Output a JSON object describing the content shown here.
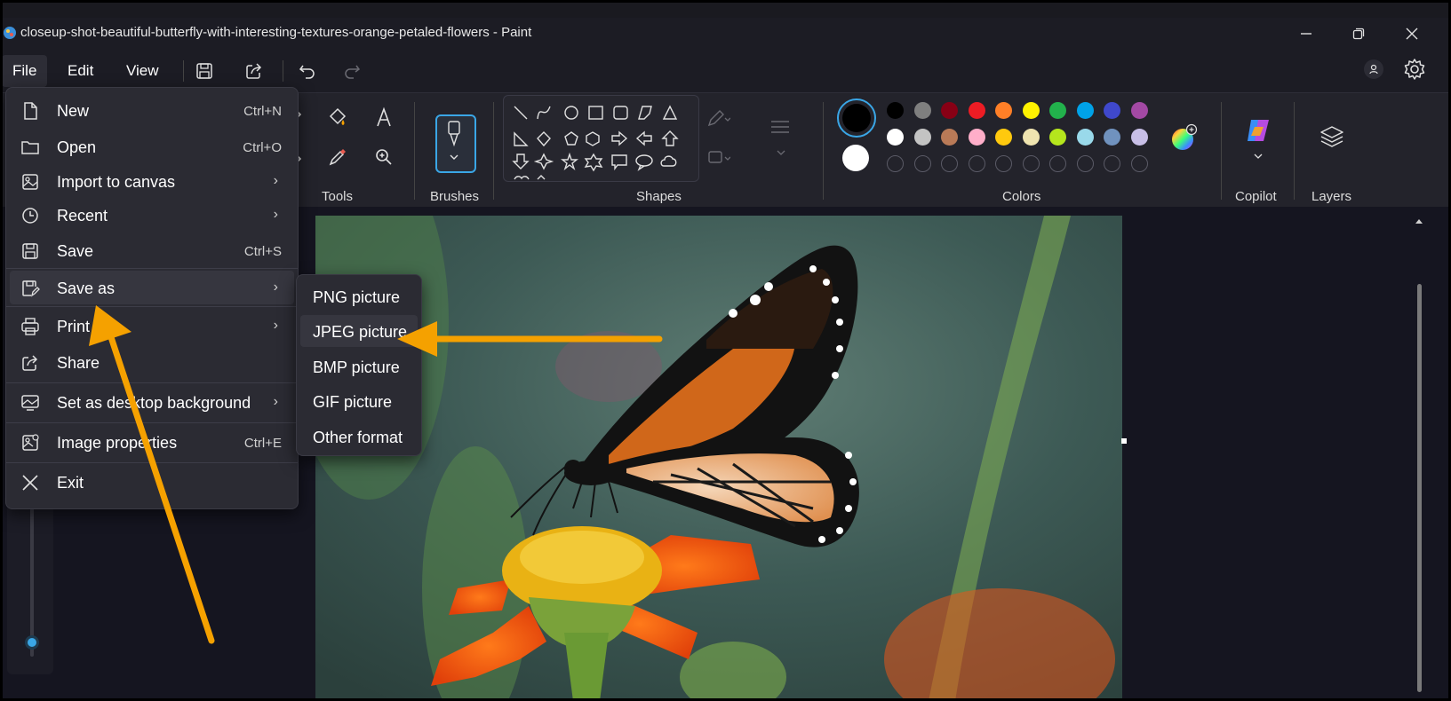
{
  "window": {
    "title": "closeup-shot-beautiful-butterfly-with-interesting-textures-orange-petaled-flowers - Paint"
  },
  "menubar": {
    "file": "File",
    "edit": "Edit",
    "view": "View"
  },
  "ribbon": {
    "tools_label": "Tools",
    "brushes_label": "Brushes",
    "shapes_label": "Shapes",
    "colors_label": "Colors",
    "copilot_label": "Copilot",
    "layers_label": "Layers",
    "palette_row1": [
      "#000000",
      "#7f7f7f",
      "#880015",
      "#ed1c24",
      "#ff7f27",
      "#fff200",
      "#22b14c",
      "#00a2e8",
      "#3f48cc",
      "#a349a4"
    ],
    "palette_row2": [
      "#ffffff",
      "#c3c3c3",
      "#b97a57",
      "#ffaec9",
      "#ffc90e",
      "#efe4b0",
      "#b5e61d",
      "#99d9ea",
      "#7092be",
      "#c8bfe7"
    ]
  },
  "file_menu": {
    "items": [
      {
        "label": "New",
        "shortcut": "Ctrl+N",
        "icon": "new-file-icon"
      },
      {
        "label": "Open",
        "shortcut": "Ctrl+O",
        "icon": "folder-icon"
      },
      {
        "label": "Import to canvas",
        "submenu": true,
        "icon": "import-icon"
      },
      {
        "label": "Recent",
        "submenu": true,
        "icon": "clock-icon"
      },
      {
        "label": "Save",
        "shortcut": "Ctrl+S",
        "icon": "save-icon"
      },
      {
        "label": "Save as",
        "submenu": true,
        "icon": "save-as-icon",
        "highlighted": true
      },
      {
        "label": "Print",
        "submenu": true,
        "icon": "printer-icon"
      },
      {
        "label": "Share",
        "icon": "share-icon"
      },
      {
        "label": "Set as desktop background",
        "submenu": true,
        "icon": "desktop-background-icon"
      },
      {
        "label": "Image properties",
        "shortcut": "Ctrl+E",
        "icon": "image-properties-icon"
      },
      {
        "label": "Exit",
        "icon": "close-icon"
      }
    ]
  },
  "save_as_menu": {
    "items": [
      "PNG picture",
      "JPEG picture",
      "BMP picture",
      "GIF picture",
      "Other format"
    ],
    "highlighted_index": 1
  },
  "annotation": {
    "arrow_color": "#f5a100"
  }
}
